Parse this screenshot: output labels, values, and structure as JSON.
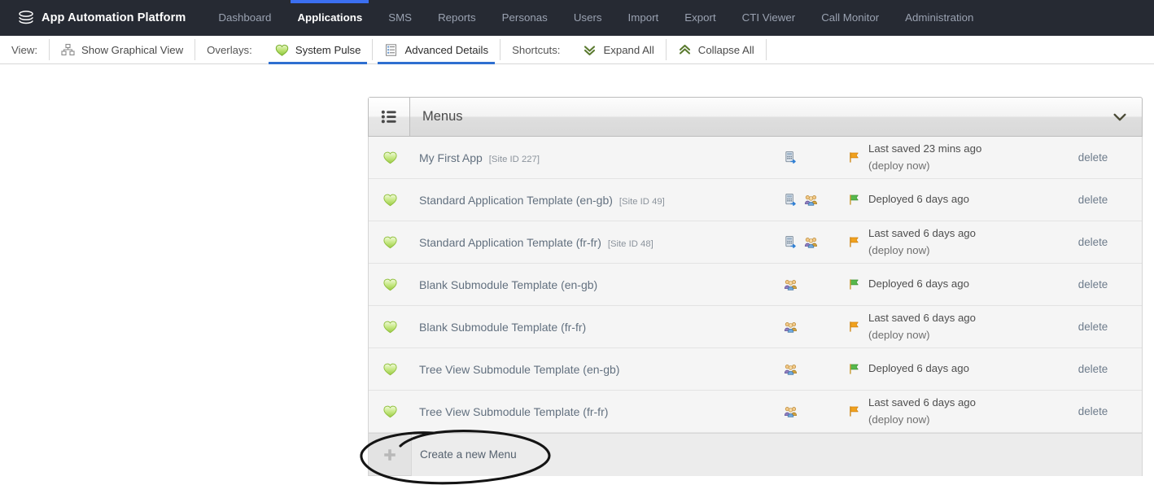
{
  "nav": {
    "brand": "App Automation Platform",
    "brand_icon": "stack-layers-icon",
    "items": [
      {
        "label": "Dashboard",
        "active": false
      },
      {
        "label": "Applications",
        "active": true
      },
      {
        "label": "SMS",
        "active": false
      },
      {
        "label": "Reports",
        "active": false
      },
      {
        "label": "Personas",
        "active": false
      },
      {
        "label": "Users",
        "active": false
      },
      {
        "label": "Import",
        "active": false
      },
      {
        "label": "Export",
        "active": false
      },
      {
        "label": "CTI Viewer",
        "active": false
      },
      {
        "label": "Call Monitor",
        "active": false
      },
      {
        "label": "Administration",
        "active": false
      }
    ]
  },
  "toolbar": {
    "view_label": "View:",
    "graphical_view": "Show Graphical View",
    "overlays_label": "Overlays:",
    "system_pulse": "System Pulse",
    "advanced_details": "Advanced Details",
    "shortcuts_label": "Shortcuts:",
    "expand_all": "Expand All",
    "collapse_all": "Collapse All"
  },
  "panel": {
    "title": "Menus",
    "header_icon": "list-bullets-icon",
    "collapse_icon": "chevron-down-icon",
    "create_label": "Create a new Menu",
    "delete_label": "delete",
    "rows": [
      {
        "status": "heart-green-icon",
        "name": "My First App",
        "site_id": "[Site ID 227]",
        "icons": [
          "device-export-icon"
        ],
        "flag": "flag-orange-icon",
        "deploy_main": "Last saved 23 mins ago",
        "deploy_sub": "(deploy now)",
        "delete": "delete"
      },
      {
        "status": "heart-green-icon",
        "name": "Standard Application Template (en-gb)",
        "site_id": "[Site ID 49]",
        "icons": [
          "device-export-icon",
          "people-group-icon"
        ],
        "flag": "flag-green-icon",
        "deploy_main": "Deployed 6 days ago",
        "deploy_sub": "",
        "delete": "delete"
      },
      {
        "status": "heart-green-icon",
        "name": "Standard Application Template (fr-fr)",
        "site_id": "[Site ID 48]",
        "icons": [
          "device-export-icon",
          "people-group-icon"
        ],
        "flag": "flag-orange-icon",
        "deploy_main": "Last saved 6 days ago",
        "deploy_sub": "(deploy now)",
        "delete": "delete"
      },
      {
        "status": "heart-green-icon",
        "name": "Blank Submodule Template (en-gb)",
        "site_id": "",
        "icons": [
          "people-group-icon"
        ],
        "flag": "flag-green-icon",
        "deploy_main": "Deployed 6 days ago",
        "deploy_sub": "",
        "delete": "delete"
      },
      {
        "status": "heart-green-icon",
        "name": "Blank Submodule Template (fr-fr)",
        "site_id": "",
        "icons": [
          "people-group-icon"
        ],
        "flag": "flag-orange-icon",
        "deploy_main": "Last saved 6 days ago",
        "deploy_sub": "(deploy now)",
        "delete": "delete"
      },
      {
        "status": "heart-green-icon",
        "name": "Tree View Submodule Template (en-gb)",
        "site_id": "",
        "icons": [
          "people-group-icon"
        ],
        "flag": "flag-green-icon",
        "deploy_main": "Deployed 6 days ago",
        "deploy_sub": "",
        "delete": "delete"
      },
      {
        "status": "heart-green-icon",
        "name": "Tree View Submodule Template (fr-fr)",
        "site_id": "",
        "icons": [
          "people-group-icon"
        ],
        "flag": "flag-orange-icon",
        "deploy_main": "Last saved 6 days ago",
        "deploy_sub": "(deploy now)",
        "delete": "delete"
      }
    ]
  },
  "annotation": {
    "shape": "hand-drawn-ellipse",
    "color": "#111111",
    "target": "Create a new Menu"
  },
  "colors": {
    "nav_bg": "#262a33",
    "nav_active": "#3b6ff0",
    "toolbar_active": "#2f6fd0",
    "row_bg": "#f5f5f5",
    "panel_border": "#bdbdbd",
    "link": "#6d7b8b"
  }
}
